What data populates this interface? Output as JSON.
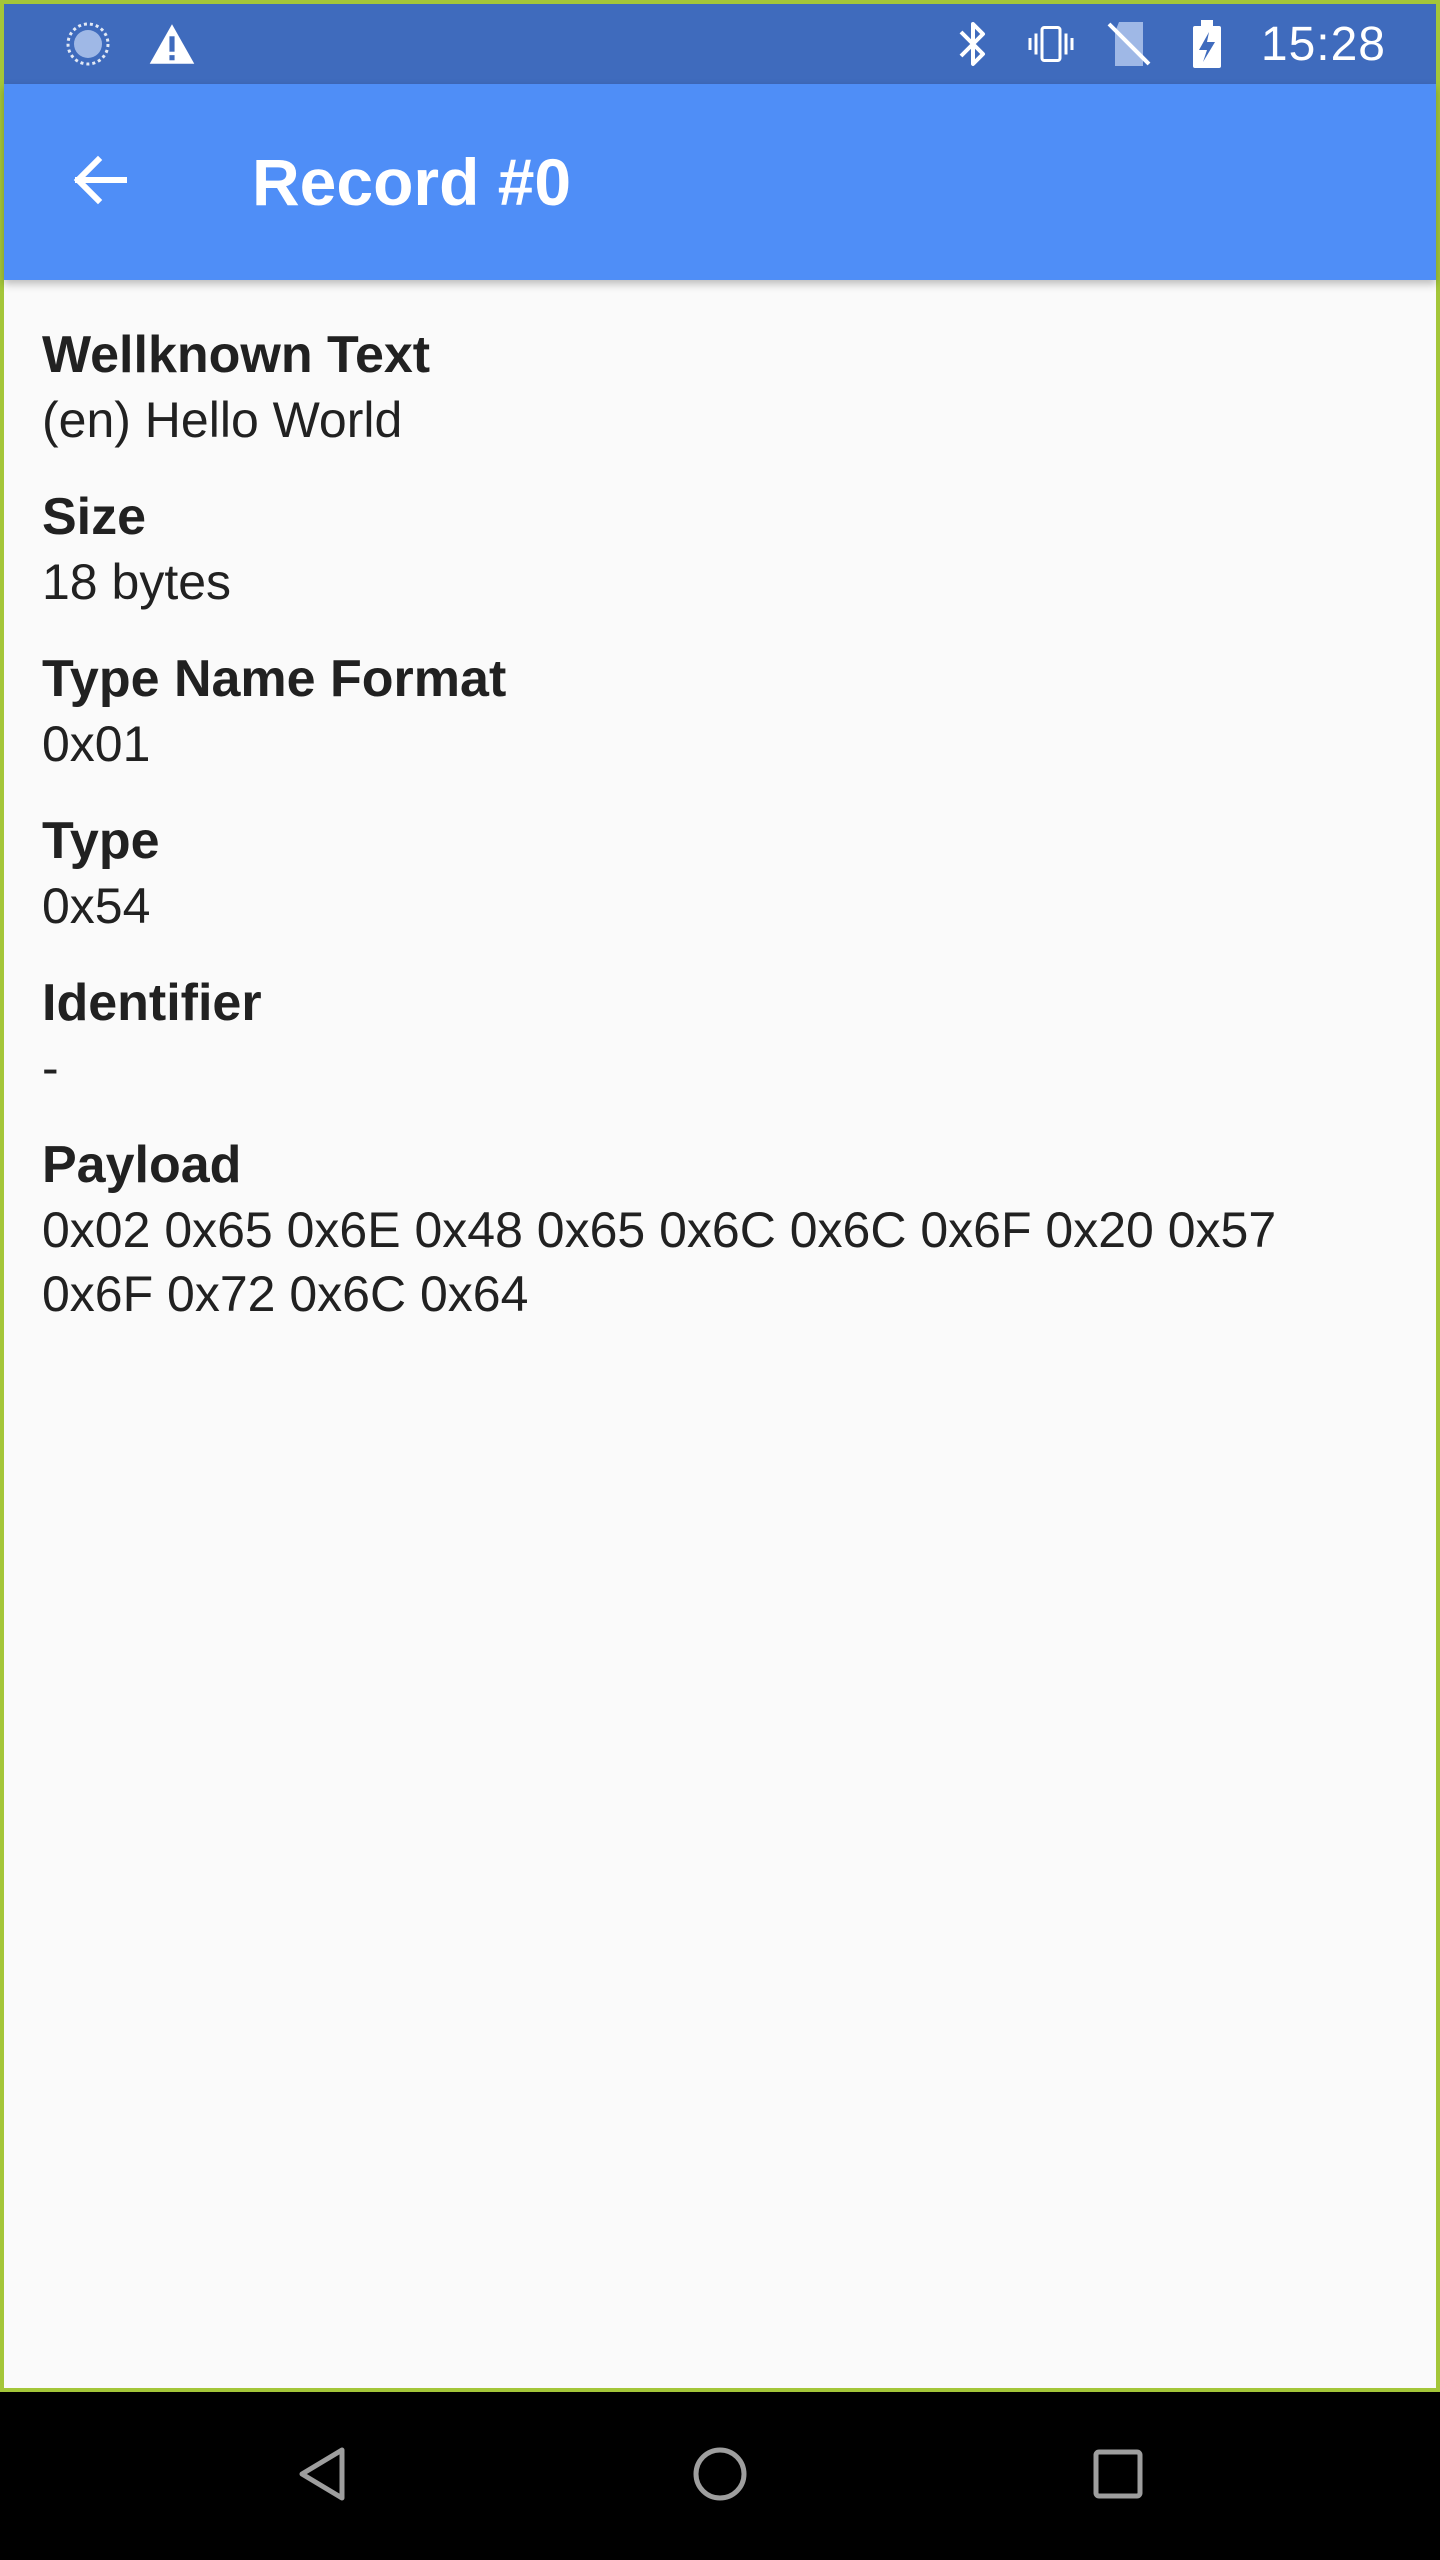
{
  "status_bar": {
    "time": "15:28",
    "left_icons": [
      "sync-icon",
      "warning-icon"
    ],
    "right_icons": [
      "bluetooth-icon",
      "vibrate-icon",
      "no-sim-icon",
      "battery-charging-icon"
    ]
  },
  "toolbar": {
    "title": "Record #0",
    "back_icon": "arrow-back-icon",
    "color": "#4f8ef7"
  },
  "fields": [
    {
      "label": "Wellknown Text",
      "value": "(en) Hello World"
    },
    {
      "label": "Size",
      "value": "18 bytes"
    },
    {
      "label": "Type Name Format",
      "value": "0x01"
    },
    {
      "label": "Type",
      "value": "0x54"
    },
    {
      "label": "Identifier",
      "value": "-"
    },
    {
      "label": "Payload",
      "value_lines": [
        "0x02 0x65 0x6E 0x48 0x65 0x6C 0x6C 0x6F 0x20 0x57",
        "0x6F 0x72 0x6C 0x64"
      ]
    }
  ],
  "nav_bar": {
    "buttons": [
      "back-triangle-icon",
      "home-circle-icon",
      "recents-square-icon"
    ]
  }
}
